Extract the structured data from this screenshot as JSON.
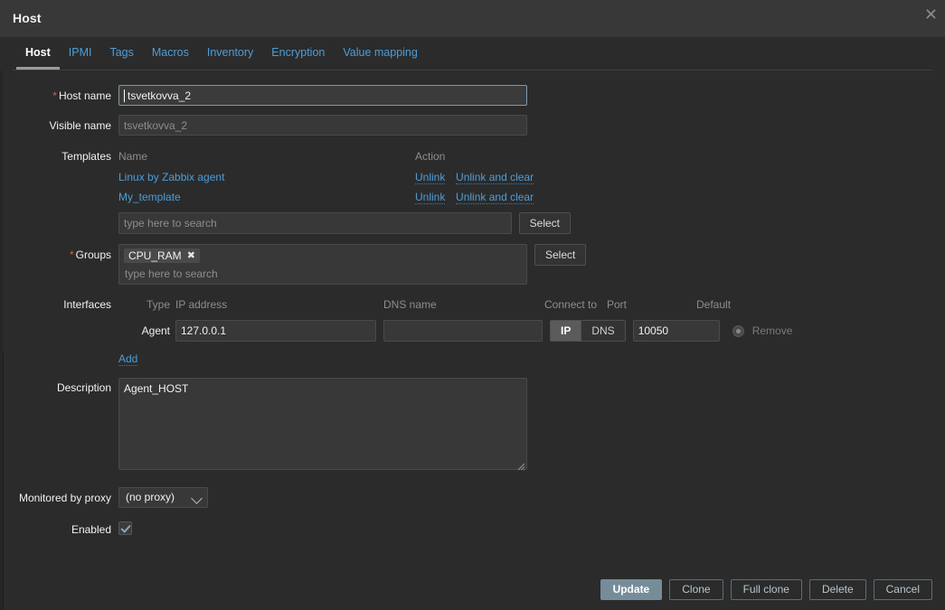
{
  "dialog": {
    "title": "Host",
    "close_icon": "close-icon"
  },
  "tabs": [
    {
      "label": "Host",
      "active": true
    },
    {
      "label": "IPMI",
      "active": false
    },
    {
      "label": "Tags",
      "active": false
    },
    {
      "label": "Macros",
      "active": false
    },
    {
      "label": "Inventory",
      "active": false
    },
    {
      "label": "Encryption",
      "active": false
    },
    {
      "label": "Value mapping",
      "active": false
    }
  ],
  "form": {
    "host_name": {
      "label": "Host name",
      "required": true,
      "value": "tsvetkovva_2"
    },
    "visible_name": {
      "label": "Visible name",
      "required": false,
      "value": "",
      "placeholder": "tsvetkovva_2"
    },
    "templates": {
      "label": "Templates",
      "col_name": "Name",
      "col_action": "Action",
      "rows": [
        {
          "name": "Linux by Zabbix agent",
          "unlink": "Unlink",
          "unlink_clear": "Unlink and clear"
        },
        {
          "name": "My_template",
          "unlink": "Unlink",
          "unlink_clear": "Unlink and clear"
        }
      ],
      "search_placeholder": "type here to search",
      "select_label": "Select"
    },
    "groups": {
      "label": "Groups",
      "required": true,
      "chips": [
        "CPU_RAM"
      ],
      "search_placeholder": "type here to search",
      "select_label": "Select"
    },
    "interfaces": {
      "label": "Interfaces",
      "headers": {
        "type": "Type",
        "ip_address": "IP address",
        "dns_name": "DNS name",
        "connect_to": "Connect to",
        "port": "Port",
        "default": "Default"
      },
      "row": {
        "type": "Agent",
        "ip_address": "127.0.0.1",
        "dns_name": "",
        "connect_ip": "IP",
        "connect_dns": "DNS",
        "connect_selected": "IP",
        "port": "10050",
        "remove_label": "Remove"
      },
      "add_label": "Add"
    },
    "description": {
      "label": "Description",
      "value": "Agent_HOST"
    },
    "proxy": {
      "label": "Monitored by proxy",
      "value": "(no proxy)"
    },
    "enabled": {
      "label": "Enabled",
      "checked": true
    }
  },
  "footer": {
    "update": "Update",
    "clone": "Clone",
    "full_clone": "Full clone",
    "delete": "Delete",
    "cancel": "Cancel"
  }
}
